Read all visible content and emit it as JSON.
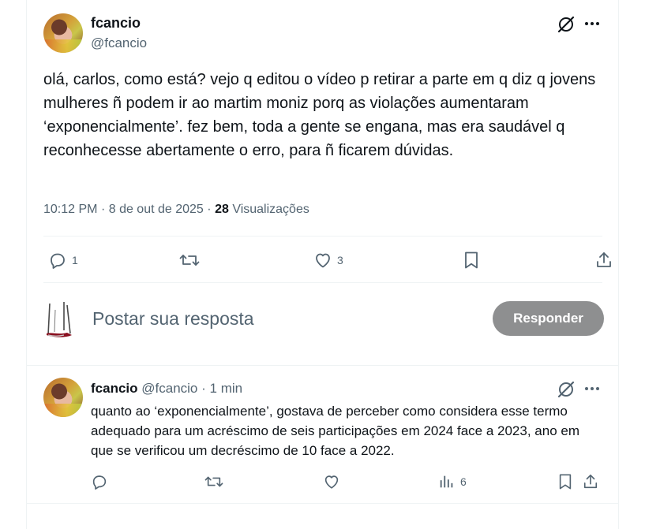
{
  "main_post": {
    "author_name": "fcancio",
    "author_handle": "@fcancio",
    "text": "olá, carlos, como está? vejo q editou o vídeo p retirar a parte em q diz q jovens mulheres ñ podem ir ao martim moniz porq as violações aumentaram ‘exponencialmente’. fez bem, toda a gente se engana, mas era saudável q reconhecesse abertamente o erro, para ñ ficarem dúvidas.",
    "time": "10:12 PM",
    "date": "8 de out de 2025",
    "separator": "·",
    "views_count": "28",
    "views_label": "Visualizações",
    "reply_count": "1",
    "repost_count": "",
    "like_count": "3"
  },
  "composer": {
    "placeholder": "Postar sua resposta",
    "button_label": "Responder"
  },
  "reply_post": {
    "author_name": "fcancio",
    "author_handle": "@fcancio",
    "separator": "·",
    "time_ago": "1 min",
    "text": "quanto ao ‘exponencialmente’, gostava de perceber como considera esse termo adequado para um acréscimo de seis participações em 2024 face a 2023, ano em que se verificou um decréscimo de 10 face a 2022.",
    "views_count": "6"
  },
  "colors": {
    "text_primary": "#0f1419",
    "text_secondary": "#536471",
    "border": "#eff3f4",
    "button_disabled": "#8e8f90"
  },
  "icons": {
    "grok": "grok-icon",
    "more": "more-icon",
    "reply": "reply-icon",
    "repost": "repost-icon",
    "like": "heart-icon",
    "bookmark": "bookmark-icon",
    "share": "share-icon",
    "views": "views-icon"
  }
}
